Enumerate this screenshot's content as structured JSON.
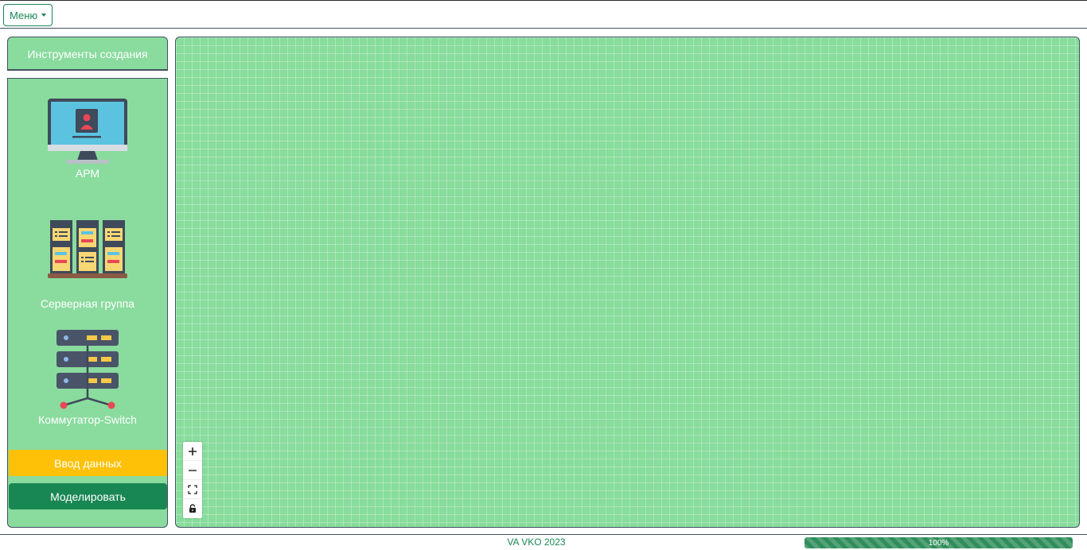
{
  "menu": {
    "label": "Меню"
  },
  "sidebar": {
    "title": "Инструменты создания",
    "tools": [
      {
        "label": "АРМ",
        "icon": "workstation-icon"
      },
      {
        "label": "Серверная группа",
        "icon": "server-group-icon"
      },
      {
        "label": "Коммутатор-Switch",
        "icon": "switch-icon"
      }
    ],
    "input_button": "Ввод данных",
    "model_button": "Моделировать"
  },
  "canvas_controls": [
    "zoom-in-icon",
    "zoom-out-icon",
    "fit-view-icon",
    "lock-icon"
  ],
  "footer": {
    "text": "VA VKO 2023",
    "progress_label": "100%",
    "progress_value": 100
  },
  "colors": {
    "panel": "#8adb9e",
    "input_button": "#ffc107",
    "model_button": "#198754",
    "progress": "#2f8e5b"
  }
}
